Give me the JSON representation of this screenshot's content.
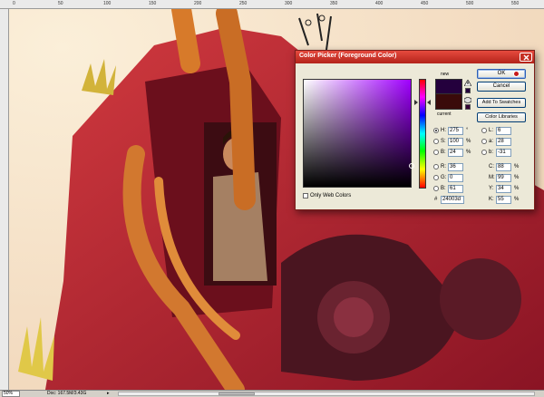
{
  "ruler": {
    "top_ticks": [
      "0",
      "50",
      "100",
      "150",
      "200",
      "250",
      "300",
      "350",
      "400",
      "450",
      "500",
      "550"
    ]
  },
  "statusbar": {
    "zoom": "50%",
    "doc": "Doc: 167.5M/3.43G",
    "arrow": "▸"
  },
  "dialog": {
    "title": "Color Picker (Foreground Color)",
    "close_icon": "close-icon",
    "new_label": "new",
    "current_label": "current",
    "new_color": "#24003d",
    "current_color": "#3a0a0a",
    "buttons": {
      "ok": "OK",
      "cancel": "Cancel",
      "add_swatches": "Add To Swatches",
      "libraries": "Color Libraries"
    },
    "hsb": [
      {
        "label": "H:",
        "value": "275",
        "unit": "°",
        "selected": true
      },
      {
        "label": "S:",
        "value": "100",
        "unit": "%",
        "selected": false
      },
      {
        "label": "B:",
        "value": "24",
        "unit": "%",
        "selected": false
      }
    ],
    "rgb": [
      {
        "label": "R:",
        "value": "36"
      },
      {
        "label": "G:",
        "value": "0"
      },
      {
        "label": "B:",
        "value": "61"
      }
    ],
    "lab": [
      {
        "label": "L:",
        "value": "6"
      },
      {
        "label": "a:",
        "value": "28"
      },
      {
        "label": "b:",
        "value": "-31"
      }
    ],
    "cmyk": [
      {
        "label": "C:",
        "value": "88",
        "unit": "%"
      },
      {
        "label": "M:",
        "value": "99",
        "unit": "%"
      },
      {
        "label": "Y:",
        "value": "34",
        "unit": "%"
      },
      {
        "label": "K:",
        "value": "55",
        "unit": "%"
      }
    ],
    "hex_label": "#",
    "hex": "24003d",
    "only_web_colors": "Only Web Colors"
  },
  "colors": {
    "accent": "#b3231a",
    "artwork_bg": "#f6e3c8",
    "vehicle": "#b8242c"
  }
}
